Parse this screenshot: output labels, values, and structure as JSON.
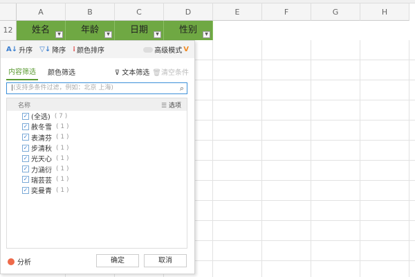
{
  "columns": [
    "A",
    "B",
    "C",
    "D",
    "E",
    "F",
    "G",
    "H"
  ],
  "row_number": "12",
  "header_cells": [
    "姓名",
    "年龄",
    "日期",
    "性别"
  ],
  "toolbar": {
    "asc": "升序",
    "desc": "降序",
    "color_sort": "颜色排序",
    "advanced": "高级模式",
    "vip_badge": "V"
  },
  "tabs": {
    "content": "内容筛选",
    "color": "颜色筛选",
    "text_filter": "文本筛选",
    "clear": "清空条件"
  },
  "search": {
    "placeholder": "(支持多条件过滤，例如：北京  上海)"
  },
  "list": {
    "header": "名称",
    "options": "选项",
    "items": [
      {
        "label": "(全选)",
        "count": "( 7 )"
      },
      {
        "label": "赦冬雪",
        "count": "( 1 )"
      },
      {
        "label": "表清芬",
        "count": "( 1 )"
      },
      {
        "label": "步清秋",
        "count": "( 1 )"
      },
      {
        "label": "光天心",
        "count": "( 1 )"
      },
      {
        "label": "力涵衍",
        "count": "( 1 )"
      },
      {
        "label": "瑞芸芸",
        "count": "( 1 )"
      },
      {
        "label": "奕曼青",
        "count": "( 1 )"
      }
    ]
  },
  "footer": {
    "analyze": "分析",
    "ok": "确定",
    "cancel": "取消"
  },
  "colors": {
    "header_green": "#6fa843",
    "accent": "#5a9a32",
    "vip": "#f08a24"
  }
}
